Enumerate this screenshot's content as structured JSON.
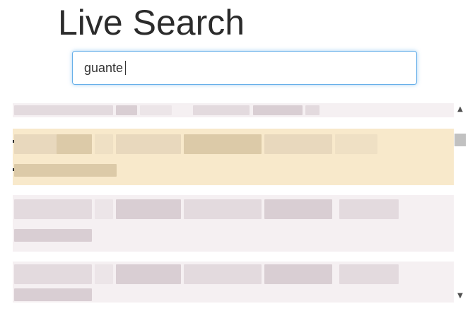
{
  "page": {
    "title": "Live Search"
  },
  "search": {
    "value": "guante",
    "placeholder": ""
  },
  "results": {
    "rows": [
      {
        "state": "partial"
      },
      {
        "state": "highlighted"
      },
      {
        "state": "normal"
      },
      {
        "state": "normal"
      }
    ]
  },
  "scrollbar": {
    "up_icon": "chevron-up-icon",
    "down_icon": "chevron-down-icon",
    "up_glyph": "▲",
    "down_glyph": "▼"
  },
  "colors": {
    "highlight": "#f8e9cb",
    "row": "#f5f0f2",
    "focus": "#66afe9"
  }
}
